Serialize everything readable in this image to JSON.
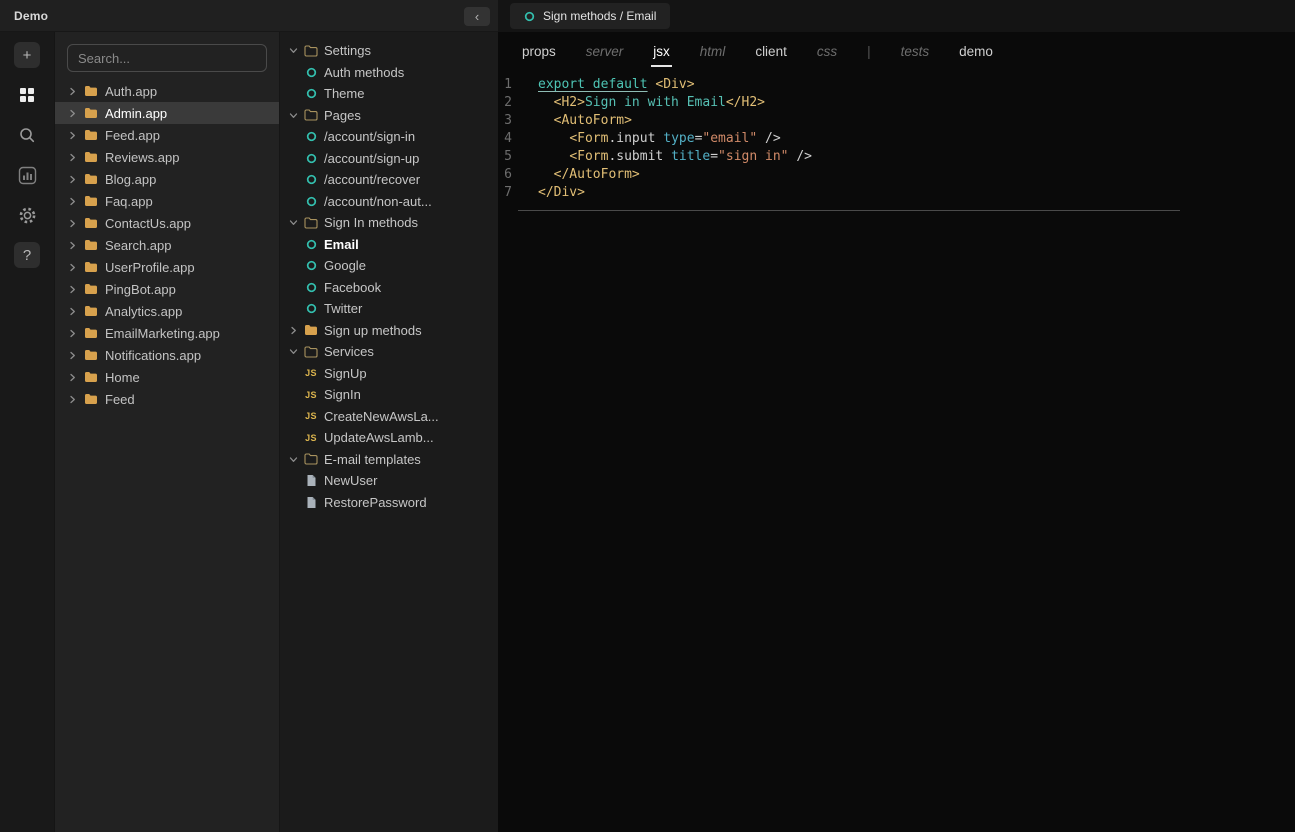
{
  "colors": {
    "accent_teal": "#33bfae",
    "folder_yellow": "#d7a14d",
    "js_yellow": "#dcb54e",
    "selection": "#3a3a3a",
    "tab_underline": "#e6e6e6"
  },
  "header": {
    "title": "Demo",
    "collapse_icon": "‹"
  },
  "activity_bar": {
    "items": [
      {
        "name": "add-button",
        "icon": "plus-icon",
        "glyph": "+",
        "boxed": true,
        "active": false
      },
      {
        "name": "apps-button",
        "icon": "grid-icon",
        "boxed": false,
        "active": true
      },
      {
        "name": "search-button",
        "icon": "search-icon",
        "boxed": false,
        "active": false
      },
      {
        "name": "media-button",
        "icon": "chart-icon",
        "boxed": false,
        "active": false
      },
      {
        "name": "settings-button",
        "icon": "gear-icon",
        "boxed": false,
        "active": false
      },
      {
        "name": "help-button",
        "icon": "help-icon",
        "glyph": "?",
        "boxed": true,
        "active": false
      }
    ]
  },
  "apps_panel": {
    "search": {
      "placeholder": "Search...",
      "value": ""
    },
    "items": [
      {
        "label": "Auth.app",
        "selected": false
      },
      {
        "label": "Admin.app",
        "selected": true
      },
      {
        "label": "Feed.app",
        "selected": false
      },
      {
        "label": "Reviews.app",
        "selected": false
      },
      {
        "label": "Blog.app",
        "selected": false
      },
      {
        "label": "Faq.app",
        "selected": false
      },
      {
        "label": "ContactUs.app",
        "selected": false
      },
      {
        "label": "Search.app",
        "selected": false
      },
      {
        "label": "UserProfile.app",
        "selected": false
      },
      {
        "label": "PingBot.app",
        "selected": false
      },
      {
        "label": "Analytics.app",
        "selected": false
      },
      {
        "label": "EmailMarketing.app",
        "selected": false
      },
      {
        "label": "Notifications.app",
        "selected": false
      },
      {
        "label": "Home",
        "selected": false
      },
      {
        "label": "Feed",
        "selected": false
      }
    ]
  },
  "tree_panel": {
    "items": [
      {
        "kind": "folder-open",
        "label": "Settings",
        "expanded": true,
        "selected": false
      },
      {
        "kind": "component",
        "label": "Auth methods",
        "selected": false
      },
      {
        "kind": "component",
        "label": "Theme",
        "selected": false
      },
      {
        "kind": "folder-open",
        "label": "Pages",
        "expanded": true,
        "selected": false
      },
      {
        "kind": "component",
        "label": "/account/sign-in",
        "selected": false
      },
      {
        "kind": "component",
        "label": "/account/sign-up",
        "selected": false
      },
      {
        "kind": "component",
        "label": "/account/recover",
        "selected": false
      },
      {
        "kind": "component",
        "label": "/account/non-aut...",
        "selected": false
      },
      {
        "kind": "folder-open",
        "label": "Sign In methods",
        "expanded": true,
        "selected": false
      },
      {
        "kind": "component",
        "label": "Email",
        "selected": true
      },
      {
        "kind": "component",
        "label": "Google",
        "selected": false
      },
      {
        "kind": "component",
        "label": "Facebook",
        "selected": false
      },
      {
        "kind": "component",
        "label": "Twitter",
        "selected": false
      },
      {
        "kind": "folder-closed",
        "label": "Sign up methods",
        "expanded": false,
        "selected": false
      },
      {
        "kind": "folder-open",
        "label": "Services",
        "expanded": true,
        "selected": false
      },
      {
        "kind": "js",
        "label": "SignUp",
        "selected": false
      },
      {
        "kind": "js",
        "label": "SignIn",
        "selected": false
      },
      {
        "kind": "js",
        "label": "CreateNewAwsLa...",
        "selected": false
      },
      {
        "kind": "js",
        "label": "UpdateAwsLamb...",
        "selected": false
      },
      {
        "kind": "folder-open",
        "label": "E-mail templates",
        "expanded": true,
        "selected": false
      },
      {
        "kind": "doc",
        "label": "NewUser",
        "selected": false
      },
      {
        "kind": "doc",
        "label": "RestorePassword",
        "selected": false
      }
    ]
  },
  "editor": {
    "tab": {
      "label": "Sign methods / Email",
      "icon": "component-icon"
    },
    "view_tabs": [
      {
        "label": "props",
        "state": "normal"
      },
      {
        "label": "server",
        "state": "empty"
      },
      {
        "label": "jsx",
        "state": "active"
      },
      {
        "label": "html",
        "state": "empty"
      },
      {
        "label": "client",
        "state": "normal"
      },
      {
        "label": "css",
        "state": "empty"
      },
      {
        "label": "|",
        "state": "separator"
      },
      {
        "label": "tests",
        "state": "empty"
      },
      {
        "label": "demo",
        "state": "normal"
      }
    ],
    "code": {
      "language": "jsx",
      "lines": [
        {
          "num": 1,
          "tokens": [
            {
              "t": "export default",
              "s": "kw u"
            },
            {
              "t": " ",
              "s": "pln"
            },
            {
              "t": "<Div>",
              "s": "tag"
            }
          ]
        },
        {
          "num": 2,
          "tokens": [
            {
              "t": "  ",
              "s": "pln"
            },
            {
              "t": "<H2>",
              "s": "tag"
            },
            {
              "t": "Sign in with Email",
              "s": "txt"
            },
            {
              "t": "</H2>",
              "s": "tag"
            }
          ]
        },
        {
          "num": 3,
          "tokens": [
            {
              "t": "  ",
              "s": "pln"
            },
            {
              "t": "<AutoForm>",
              "s": "tag"
            }
          ]
        },
        {
          "num": 4,
          "tokens": [
            {
              "t": "    ",
              "s": "pln"
            },
            {
              "t": "<Form",
              "s": "tag"
            },
            {
              "t": ".input",
              "s": "pln"
            },
            {
              "t": " ",
              "s": "pln"
            },
            {
              "t": "type",
              "s": "attr"
            },
            {
              "t": "=",
              "s": "pln"
            },
            {
              "t": "\"email\"",
              "s": "str"
            },
            {
              "t": " />",
              "s": "pln"
            }
          ]
        },
        {
          "num": 5,
          "tokens": [
            {
              "t": "    ",
              "s": "pln"
            },
            {
              "t": "<Form",
              "s": "tag"
            },
            {
              "t": ".submit",
              "s": "pln"
            },
            {
              "t": " ",
              "s": "pln"
            },
            {
              "t": "title",
              "s": "attr"
            },
            {
              "t": "=",
              "s": "pln"
            },
            {
              "t": "\"sign in\"",
              "s": "str"
            },
            {
              "t": " />",
              "s": "pln"
            }
          ]
        },
        {
          "num": 6,
          "tokens": [
            {
              "t": "  ",
              "s": "pln"
            },
            {
              "t": "</AutoForm>",
              "s": "tag"
            }
          ]
        },
        {
          "num": 7,
          "tokens": [
            {
              "t": "</Div>",
              "s": "tag"
            }
          ]
        }
      ]
    }
  }
}
